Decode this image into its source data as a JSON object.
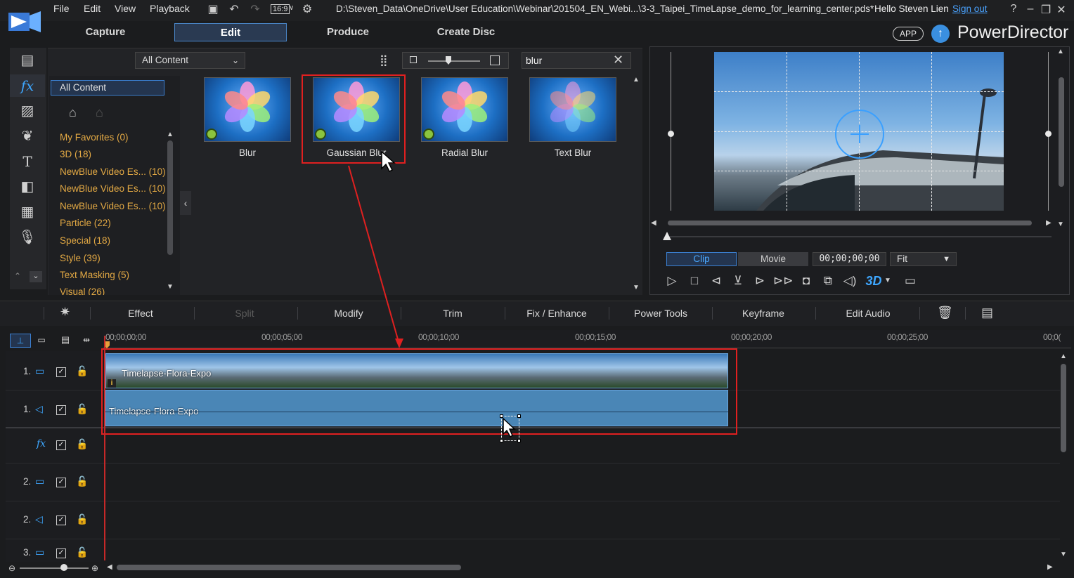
{
  "titlebar": {
    "menu": [
      "File",
      "Edit",
      "View",
      "Playback"
    ],
    "aspect_ratio": "16:9",
    "file_path": "D:\\Steven_Data\\OneDrive\\User Education\\Webinar\\201504_EN_Webi...\\3-3_Taipei_TimeLapse_demo_for_learning_center.pds*",
    "greeting": "Hello Steven Lien",
    "signout": "Sign out",
    "help": "?"
  },
  "modes": {
    "capture": "Capture",
    "edit": "Edit",
    "produce": "Produce",
    "create_disc": "Create Disc"
  },
  "brand": {
    "app_badge": "APP",
    "name": "PowerDirector"
  },
  "library": {
    "content_filter": "All Content",
    "search_value": "blur",
    "category_selected": "All Content",
    "categories": [
      "My Favorites  (0)",
      "3D  (18)",
      "NewBlue Video Es...  (10)",
      "NewBlue Video Es...  (10)",
      "NewBlue Video Es...  (10)",
      "Particle  (22)",
      "Special  (18)",
      "Style  (39)",
      "Text Masking  (5)",
      "Visual  (26)"
    ],
    "effects": [
      {
        "label": "Blur"
      },
      {
        "label": "Gaussian Blur"
      },
      {
        "label": "Radial Blur"
      },
      {
        "label": "Text Blur"
      }
    ]
  },
  "preview": {
    "clip_label": "Clip",
    "movie_label": "Movie",
    "timecode": "00;00;00;00",
    "fit": "Fit",
    "three_d": "3D"
  },
  "edit_toolbar": {
    "effect": "Effect",
    "split": "Split",
    "modify": "Modify",
    "trim": "Trim",
    "fix_enhance": "Fix / Enhance",
    "power_tools": "Power Tools",
    "keyframe": "Keyframe",
    "edit_audio": "Edit Audio"
  },
  "timeline": {
    "ruler": [
      "00;00;00;00",
      "00;00;05;00",
      "00;00;10;00",
      "00;00;15;00",
      "00;00;20;00",
      "00;00;25;00",
      "00;0("
    ],
    "tracks": [
      {
        "num": "1.",
        "type": "video"
      },
      {
        "num": "1.",
        "type": "audio"
      },
      {
        "num": "",
        "type": "fx"
      },
      {
        "num": "2.",
        "type": "video"
      },
      {
        "num": "2.",
        "type": "audio"
      },
      {
        "num": "3.",
        "type": "video"
      }
    ],
    "video_clip_label": "Timelapse-Flora-Expo",
    "audio_clip_label": "Timelapse-Flora-Expo"
  },
  "colors": {
    "accent": "#3ea7ff",
    "highlight_box": "#e02020",
    "category_text": "#e3a944",
    "playhead": "#c62828"
  }
}
